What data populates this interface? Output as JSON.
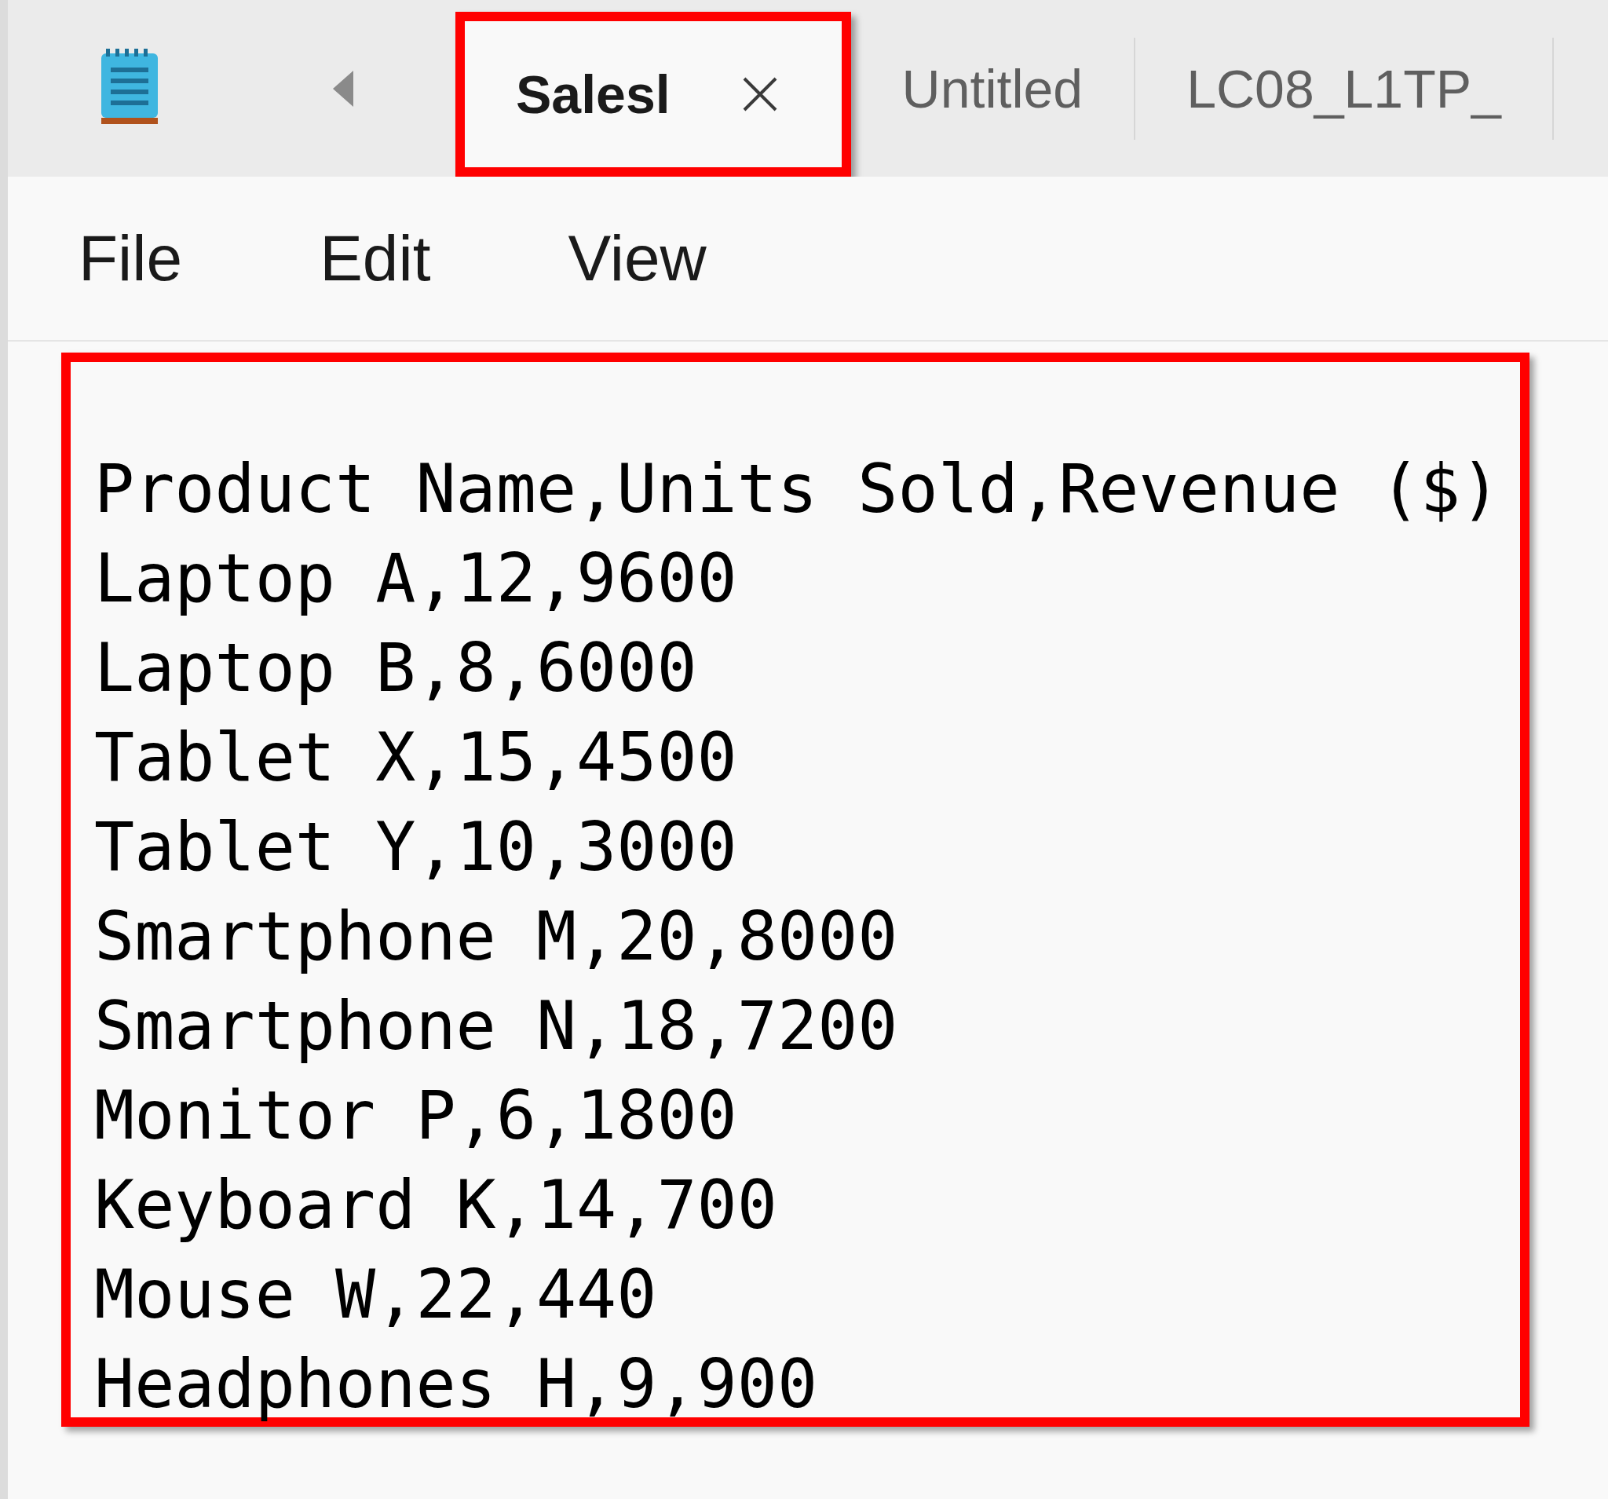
{
  "tabs": [
    {
      "label": "Salesl",
      "selected": true
    },
    {
      "label": "Untitled",
      "selected": false
    },
    {
      "label": "LC08_L1TP_",
      "selected": false
    }
  ],
  "menu": [
    "File",
    "Edit",
    "View"
  ],
  "editor": {
    "lines": [
      "Product Name,Units Sold,Revenue ($)",
      "Laptop A,12,9600",
      "Laptop B,8,6000",
      "Tablet X,15,4500",
      "Tablet Y,10,3000",
      "Smartphone M,20,8000",
      "Smartphone N,18,7200",
      "Monitor P,6,1800",
      "Keyboard K,14,700",
      "Mouse W,22,440",
      "Headphones H,9,900"
    ]
  }
}
